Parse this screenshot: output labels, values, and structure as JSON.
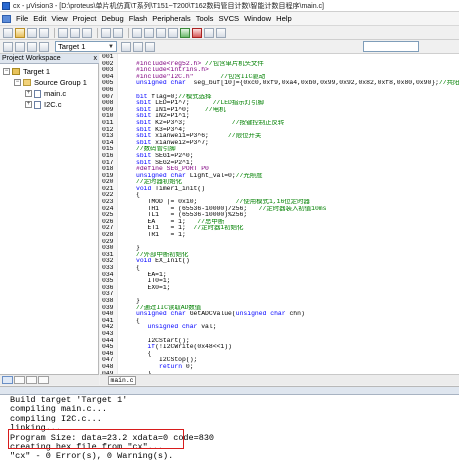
{
  "window": {
    "title": "cx - μVision3 - [D:\\proteus\\单片机仿真\\T系列\\T151~T200\\T162数码管目计数\\智能计数目程序\\main.c]"
  },
  "menu": {
    "items": [
      "File",
      "Edit",
      "View",
      "Project",
      "Debug",
      "Flash",
      "Peripherals",
      "Tools",
      "SVCS",
      "Window",
      "Help"
    ]
  },
  "toolbar": {
    "target": "Target 1"
  },
  "workspace": {
    "title": "Project Workspace",
    "close": "x",
    "tree": [
      {
        "label": "Target 1",
        "level": 0,
        "toggle": "−"
      },
      {
        "label": "Source Group 1",
        "level": 1,
        "toggle": "−"
      },
      {
        "label": "main.c",
        "level": 2,
        "toggle": "+"
      },
      {
        "label": "I2C.c",
        "level": 2,
        "toggle": "+"
      }
    ]
  },
  "editor": {
    "file_tab": "main.c",
    "line_numbers": [
      "001",
      "002",
      "003",
      "004",
      "005",
      "006",
      "007",
      "008",
      "009",
      "010",
      "011",
      "012",
      "013",
      "014",
      "015",
      "016",
      "017",
      "018",
      "019",
      "020",
      "021",
      "022",
      "023",
      "024",
      "025",
      "026",
      "027",
      "028",
      "029",
      "030",
      "031",
      "032",
      "033",
      "034",
      "035",
      "036",
      "037",
      "038",
      "039",
      "040",
      "041",
      "042",
      "043",
      "044",
      "045",
      "046",
      "047",
      "048",
      "049",
      "050"
    ],
    "lines": [
      "",
      "#include<reg52.h> //包含单片机头文件",
      "#include<intrins.h>",
      "#include\"I2C.h\"       //包含IIC驱动",
      "unsigned char  seg_buf[10]={0xc0,0xf9,0xa4,0xb0,0x99,0x92,0x82,0xf8,0x80,0x90};//共阳数码管显示当",
      "",
      "bit flag=0;//模式选择",
      "sbit LED=P1^7;      //LED指示灯引脚",
      "sbit IN1=P1^0;    //电机",
      "sbit IN2=P1^1;",
      "sbit K2=P3^3;            //按键控制正反转",
      "sbit K3=P3^4;",
      "sbit xianwei1=P3^6;     //限位开关",
      "sbit xianwei2=P3^7;",
      "//数码管引脚",
      "sbit SEG1=P2^0;",
      "sbit SEG2=P2^1;",
      "#define SEG_PORT P0",
      "unsigned char Light_val=0;//光照度",
      "//定时器初始化",
      "void Timer1_init()",
      "{",
      "   TMOD |= 0x10;          //使用模式1,16位定时器",
      "   TH1   = (65536-10000)/256;   //定时器装入初值10ms",
      "   TL1   = (65536-10000)%256;",
      "   EA    = 1;   //总中断",
      "   ET1   = 1;  //定时器1初始化",
      "   TR1   = 1;",
      "",
      "}",
      "//外部中断初始化",
      "void EX_Init()",
      "{",
      "   EA=1;",
      "   IT0=1;",
      "   EX0=1;",
      "",
      "}",
      "//通过IIC读取AD数值",
      "unsigned char GetADCValue(unsigned char chn)",
      "{",
      "   unsigned char val;",
      "",
      "   I2CStart();",
      "   if(!I2CWrite(0x48<<1))",
      "   {",
      "      I2CStop();",
      "      return 0;",
      "   }",
      ""
    ]
  },
  "build": {
    "lines": [
      "Build target 'Target 1'",
      "compiling main.c...",
      "compiling I2C.c...",
      "linking...",
      "Program Size: data=23.2 xdata=0 code=830",
      "creating hex file from \"cx\"...",
      "\"cx\" - 0 Error(s), 0 Warning(s)."
    ]
  }
}
